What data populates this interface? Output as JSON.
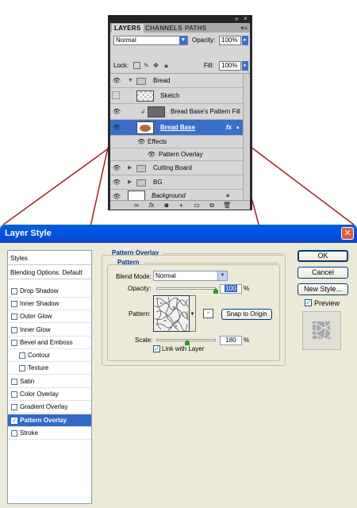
{
  "layers_panel": {
    "palette_controls": {
      "collapse": "«",
      "close": "×"
    },
    "tabs": [
      "LAYERS",
      "CHANNELS",
      "PATHS"
    ],
    "tab_menu": "▾≡",
    "blend_mode": "Normal",
    "opacity_label": "Opacity:",
    "opacity_value": "100%",
    "lock_label": "Lock:",
    "fill_label": "Fill:",
    "fill_value": "100%",
    "layers": [
      {
        "name": "Bread",
        "type": "group",
        "visible": true,
        "expanded": true
      },
      {
        "name": "Sketch",
        "type": "layer",
        "visible": false
      },
      {
        "name": "Bread Base's Pattern Fill",
        "type": "clipped-layer",
        "visible": true
      },
      {
        "name": "Bread Base",
        "type": "layer",
        "visible": true,
        "selected": true,
        "fx": "fx"
      },
      {
        "name": "Effects",
        "type": "effects-header",
        "visible": true
      },
      {
        "name": "Pattern Overlay",
        "type": "effect",
        "visible": true
      },
      {
        "name": "Cutting Board",
        "type": "group",
        "visible": true,
        "expanded": false
      },
      {
        "name": "BG",
        "type": "group",
        "visible": true,
        "expanded": false
      },
      {
        "name": "Background",
        "type": "layer",
        "visible": true,
        "locked": true
      }
    ]
  },
  "dialog": {
    "title": "Layer Style",
    "style_list": [
      {
        "label": "Styles",
        "checkbox": false
      },
      {
        "label": "Blending Options: Default",
        "checkbox": false
      },
      {
        "label": "Drop Shadow",
        "checkbox": true,
        "checked": false
      },
      {
        "label": "Inner Shadow",
        "checkbox": true,
        "checked": false
      },
      {
        "label": "Outer Glow",
        "checkbox": true,
        "checked": false
      },
      {
        "label": "Inner Glow",
        "checkbox": true,
        "checked": false
      },
      {
        "label": "Bevel and Emboss",
        "checkbox": true,
        "checked": false
      },
      {
        "label": "Contour",
        "checkbox": true,
        "checked": false,
        "indent": true
      },
      {
        "label": "Texture",
        "checkbox": true,
        "checked": false,
        "indent": true
      },
      {
        "label": "Satin",
        "checkbox": true,
        "checked": false
      },
      {
        "label": "Color Overlay",
        "checkbox": true,
        "checked": false
      },
      {
        "label": "Gradient Overlay",
        "checkbox": true,
        "checked": false
      },
      {
        "label": "Pattern Overlay",
        "checkbox": true,
        "checked": true,
        "selected": true
      },
      {
        "label": "Stroke",
        "checkbox": true,
        "checked": false
      }
    ],
    "section_title": "Pattern Overlay",
    "group_title": "Pattern",
    "blend_mode_label": "Blend Mode:",
    "blend_mode_value": "Normal",
    "opacity_label": "Opacity:",
    "opacity_value": "100",
    "opacity_slider_fraction": 1.0,
    "percent": "%",
    "pattern_label": "Pattern:",
    "snap_button": "Snap to Origin",
    "scale_label": "Scale:",
    "scale_value": "180",
    "link_label": "Link with Layer",
    "link_checked": true,
    "ok_button": "OK",
    "cancel_button": "Cancel",
    "new_style_button": "New Style...",
    "preview_label": "Preview",
    "preview_checked": true
  },
  "colors": {
    "selection_blue": "#3a6fc9",
    "xp_title_blue": "#0054e3",
    "connector_red": "#a0201e"
  }
}
